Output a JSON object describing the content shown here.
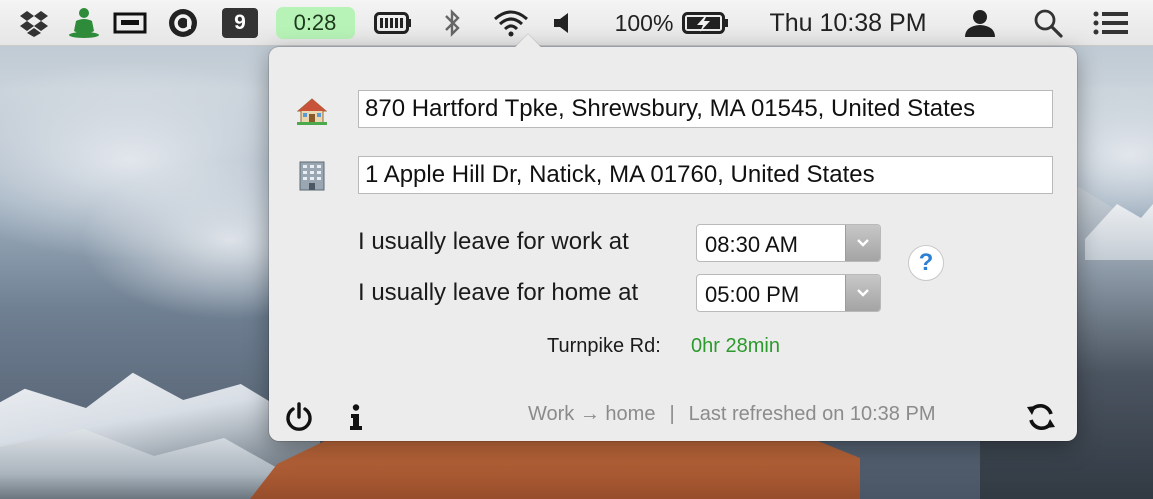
{
  "menubar": {
    "icons": [
      "dropbox-icon",
      "meditation-icon",
      "window-switcher-icon",
      "circle-a-icon",
      "battery-icon",
      "bluetooth-icon",
      "wifi-icon",
      "volume-icon",
      "charging-battery-icon",
      "user-icon",
      "spotlight-search-icon",
      "notification-center-icon"
    ],
    "badge_count": "9",
    "timer": "0:28",
    "battery_percent": "100%",
    "clock": "Thu 10:38 PM",
    "colors": {
      "timer_bg": "#b7f3b7",
      "dark_badge": "#333333"
    }
  },
  "popover": {
    "home_address": "870 Hartford Tpke, Shrewsbury, MA  01545, United States",
    "work_address": "1 Apple Hill Dr, Natick, MA  01760, United States",
    "home_icon": "house-icon",
    "work_icon": "office-building-icon",
    "work_leave_label": "I usually leave for work at",
    "work_leave_time": "08:30 AM",
    "home_leave_label": "I usually leave for home at",
    "home_leave_time": "05:00 PM",
    "help_label": "?",
    "route_name": "Turnpike Rd:",
    "route_duration": "0hr 28min",
    "direction": "Work → home",
    "separator": "|",
    "last_refreshed": "Last refreshed on 10:38 PM",
    "colors": {
      "route_duration": "#2c9a2c",
      "help": "#2d7fd3"
    }
  }
}
